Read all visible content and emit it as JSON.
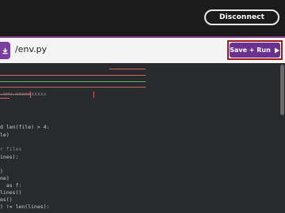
{
  "header": {
    "disconnect_label": "Disconnect"
  },
  "file": {
    "name": "/env.py"
  },
  "toolbar": {
    "run_label": "Save + Run"
  },
  "colors": {
    "accent": "#7a3fa1",
    "highlight": "#9c1a1a"
  },
  "icons": {
    "download": "download-icon",
    "play": "play-icon"
  },
  "code": {
    "lines": [
      ".env.xxxxxxxxxx",
      "d len(file) > 4:",
      "le)",
      "r files",
      "ines):",
      ")",
      "ne)",
      "  as f:",
      "lines()",
      "es()",
      ") != len(lines):"
    ]
  }
}
